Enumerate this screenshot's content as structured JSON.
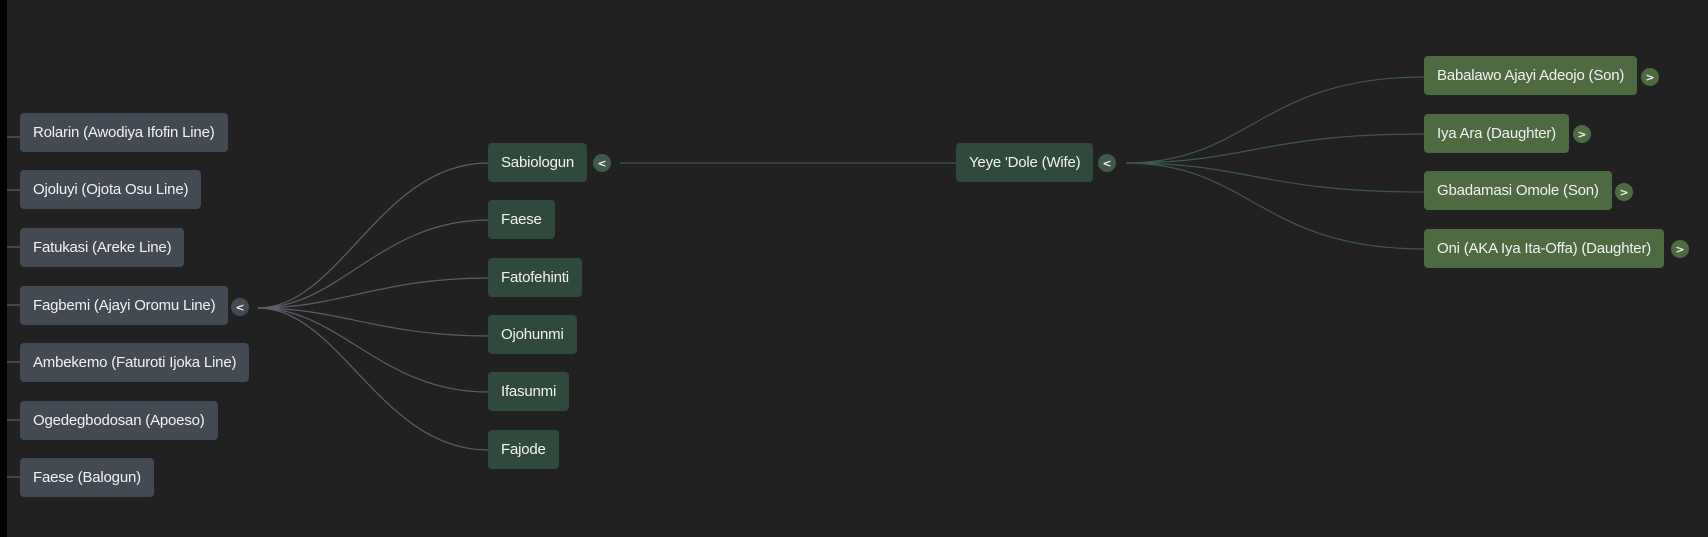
{
  "left_column": {
    "nodes": [
      "Rolarin (Awodiya Ifofin Line)",
      "Ojoluyi (Ojota Osu Line)",
      "Fatukasi (Areke Line)",
      "Fagbemi (Ajayi Oromu Line)",
      "Ambekemo (Faturoti Ijoka Line)",
      "Ogedegbodosan (Apoeso)",
      "Faese (Balogun)"
    ],
    "toggle": "<"
  },
  "middle_column": {
    "nodes": [
      "Sabiologun",
      "Faese",
      "Fatofehinti",
      "Ojohunmi",
      "Ifasunmi",
      "Fajode"
    ],
    "toggle": "<"
  },
  "center_node": {
    "label": "Yeye 'Dole (Wife)",
    "toggle": "<"
  },
  "right_column": {
    "nodes": [
      "Babalawo Ajayi Adeojo (Son)",
      "Iya Ara (Daughter)",
      "Gbadamasi Omole (Son)",
      "Oni (AKA Iya Ita-Offa) (Daughter)"
    ],
    "toggle": ">"
  },
  "colors": {
    "background": "#212121",
    "left_node": "#434a54",
    "middle_node": "#2f4a3d",
    "right_node": "#4e6a40",
    "grey_connector": "#5b5f66",
    "green_connector": "#3e5a48",
    "text": "#f2f2f2"
  }
}
